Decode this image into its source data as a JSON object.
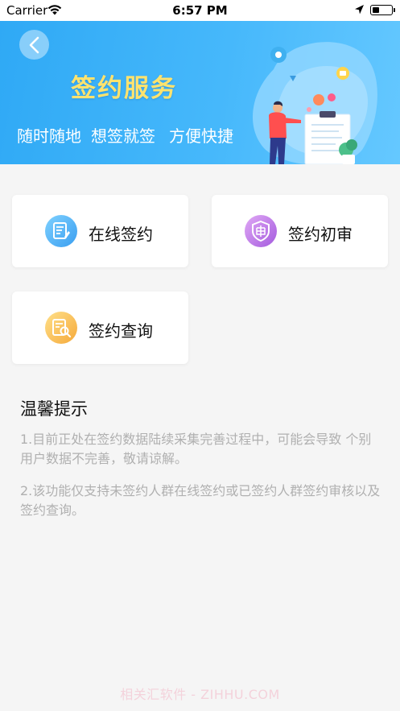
{
  "status_bar": {
    "carrier": "Carrier",
    "time": "6:57 PM",
    "battery_level": 0.35
  },
  "banner": {
    "title": "签约服务",
    "slogans": [
      "随时随地",
      "想签就签",
      "方便快捷"
    ],
    "back_icon": "chevron-left-icon"
  },
  "services": [
    {
      "label": "在线签约",
      "icon": "document-edit-icon",
      "color": "#4fb3f4"
    },
    {
      "label": "签约初审",
      "icon": "shield-review-icon",
      "color": "#c47ce8"
    },
    {
      "label": "签约查询",
      "icon": "document-search-icon",
      "color": "#f8c35a"
    }
  ],
  "tips": {
    "title": "温馨提示",
    "items": [
      "1.目前正处在签约数据陆续采集完善过程中，可能会导致 个别用户数据不完善，敬请谅解。",
      "2.该功能仅支持未签约人群在线签约或已签约人群签约审核以及签约查询。"
    ]
  },
  "watermark": "相关汇软件 - ZIHHU.COM",
  "colors": {
    "banner_start": "#2fa9f5",
    "banner_end": "#65c8ff",
    "title_yellow": "#ffe36e",
    "page_bg": "#f5f5f5",
    "tip_text": "#b0b0b0"
  }
}
